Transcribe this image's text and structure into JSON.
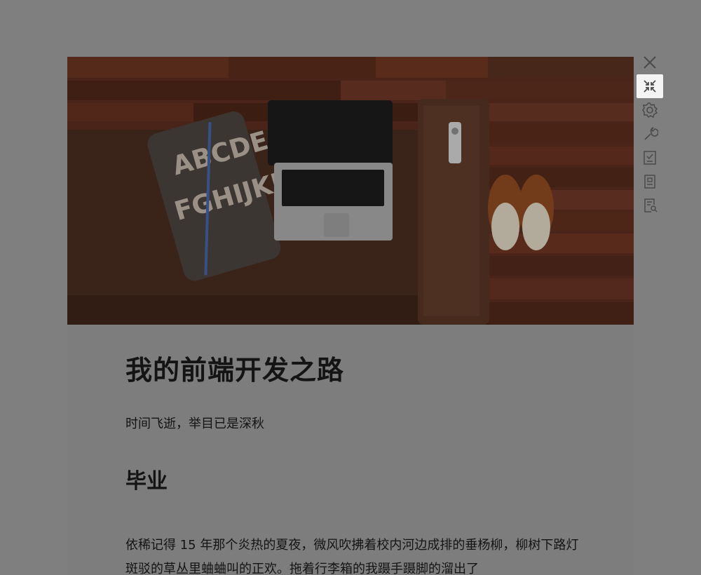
{
  "article": {
    "title": "我的前端开发之路",
    "subtitle": "时间飞逝，举目已是深秋",
    "section_heading": "毕业",
    "paragraph": "依稀记得 15 年那个炎热的夏夜，微风吹拂着校内河边成排的垂杨柳，柳树下路灯斑驳的草丛里蛐蛐叫的正欢。拖着行李箱的我蹑手蹑脚的溜出了",
    "pillow_text": [
      "ABCDE",
      "FGHIJKL"
    ]
  },
  "toolbar": {
    "icons": [
      "close-icon",
      "exit-fullscreen-icon",
      "gear-icon",
      "wrench-icon",
      "checklist-icon",
      "document-icon",
      "search-document-icon"
    ],
    "active_icon": "exit-fullscreen-icon"
  },
  "colors": {
    "overlay": "#7f7f7f",
    "reader_background": "#7d7d7d",
    "text": "#141414",
    "active_tool_background": "#f4f4f4",
    "icon": "#4a4a4a"
  }
}
